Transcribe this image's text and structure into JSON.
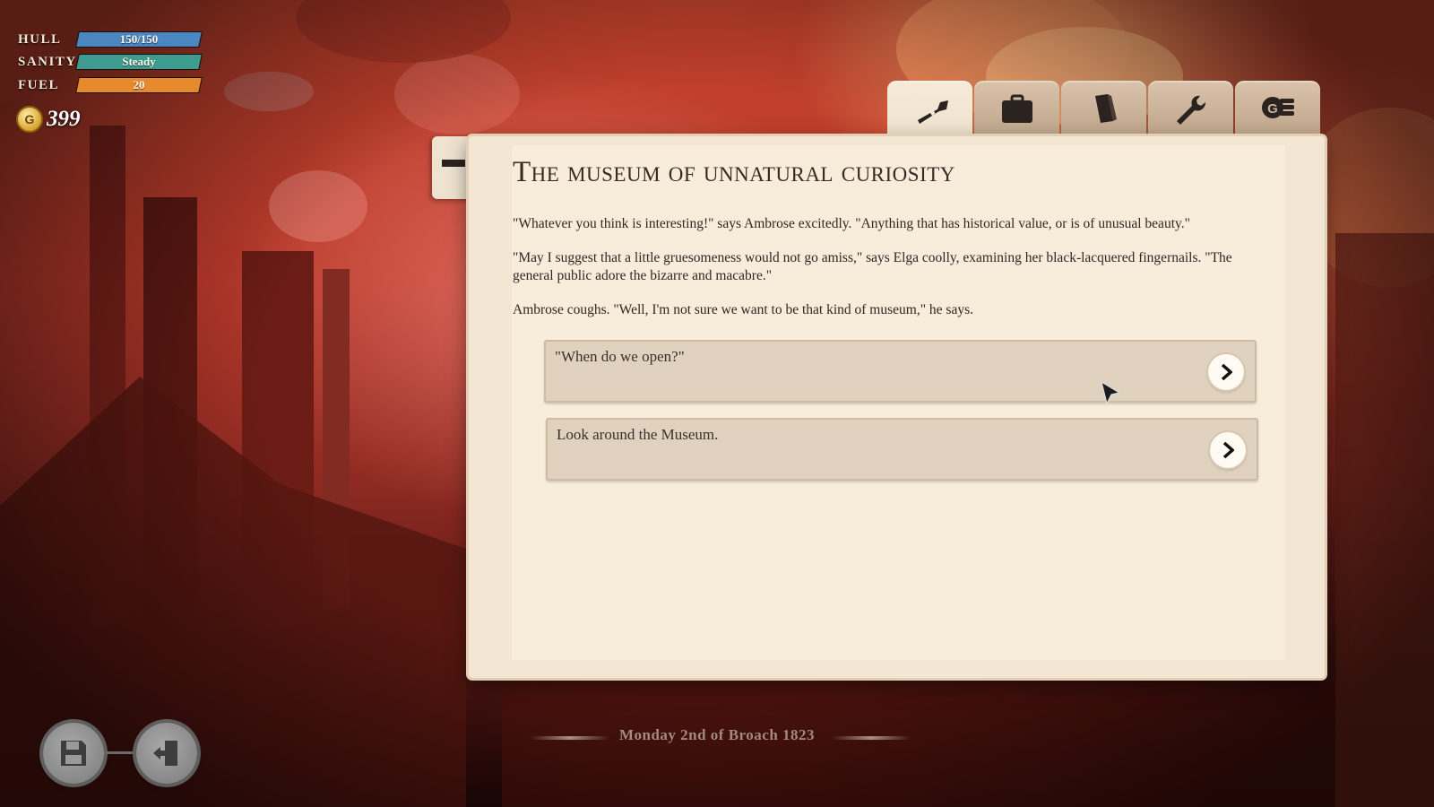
{
  "hud": {
    "hull": {
      "label": "HULL",
      "value": "150/150",
      "fill": 1.0,
      "color": "#4a86c0"
    },
    "sanity": {
      "label": "SANITY",
      "value": "Steady",
      "fill": 1.0,
      "color": "#3e9b8f"
    },
    "fuel": {
      "label": "FUEL",
      "value": "20",
      "fill": 1.0,
      "color": "#e78a2e"
    },
    "coins": {
      "symbol": "G",
      "value": "399"
    }
  },
  "tabs": [
    {
      "name": "key",
      "icon": "key-icon",
      "active": true
    },
    {
      "name": "inventory",
      "icon": "briefcase-icon",
      "active": false
    },
    {
      "name": "journal",
      "icon": "book-icon",
      "active": false
    },
    {
      "name": "repairs",
      "icon": "wrench-icon",
      "active": false
    },
    {
      "name": "trade",
      "icon": "coins-icon",
      "active": false
    }
  ],
  "story": {
    "title": "The museum of unnatural curiosity",
    "paragraphs": [
      "\"Whatever you think is interesting!\" says Ambrose excitedly. \"Anything that has historical value, or is of unusual beauty.\"",
      "\"May I suggest that a little gruesomeness would not go amiss,\" says Elga coolly, examining her black-lacquered fingernails. \"The general public adore the bizarre and macabre.\"",
      "Ambrose coughs. \"Well, I'm not sure we want to be that kind of museum,\" he says."
    ],
    "choices": [
      {
        "text": "\"When do we open?\""
      },
      {
        "text": "Look around the Museum."
      }
    ]
  },
  "footer": {
    "date": "Monday 2nd of Broach 1823"
  }
}
